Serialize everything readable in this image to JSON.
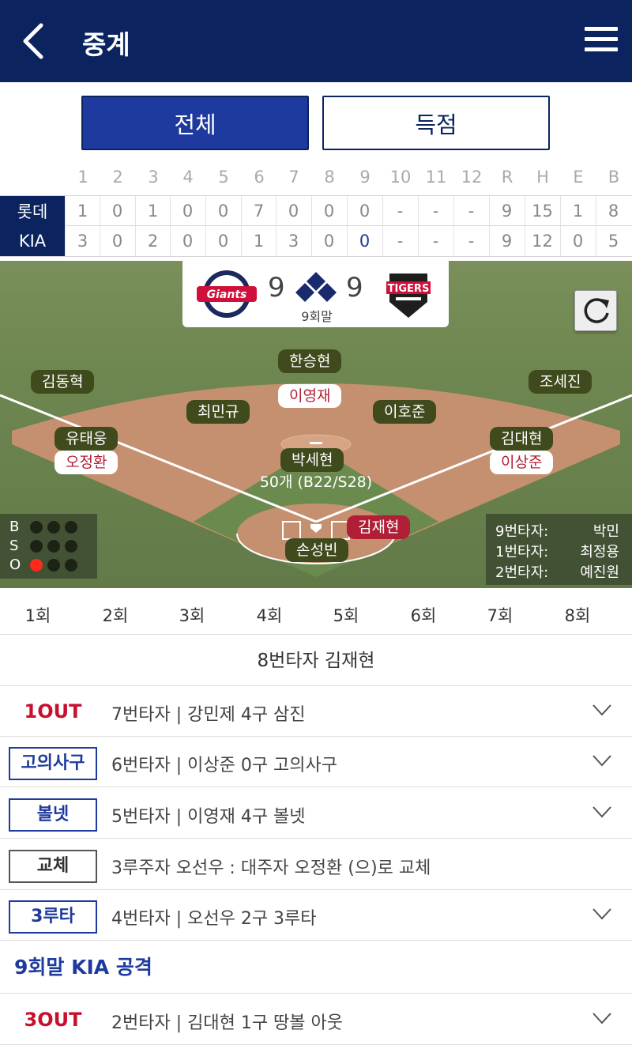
{
  "header": {
    "title": "중계"
  },
  "toggle": {
    "all": "전체",
    "scoring": "득점"
  },
  "scoreboard": {
    "columns": [
      "1",
      "2",
      "3",
      "4",
      "5",
      "6",
      "7",
      "8",
      "9",
      "10",
      "11",
      "12",
      "R",
      "H",
      "E",
      "B"
    ],
    "rows": [
      {
        "team": "롯데",
        "cells": [
          "1",
          "0",
          "1",
          "0",
          "0",
          "7",
          "0",
          "0",
          "0",
          "-",
          "-",
          "-",
          "9",
          "15",
          "1",
          "8"
        ]
      },
      {
        "team": "KIA",
        "cells": [
          "3",
          "0",
          "2",
          "0",
          "0",
          "1",
          "3",
          "0",
          "0",
          "-",
          "-",
          "-",
          "9",
          "12",
          "0",
          "5"
        ]
      }
    ]
  },
  "game": {
    "away_score": "9",
    "home_score": "9",
    "inning": "9회말"
  },
  "field": {
    "fielders": {
      "cf": "한승현",
      "lf": "김동혁",
      "rf": "조세진",
      "ss": "최민규",
      "second": "이호준",
      "third": "유태웅",
      "first": "김대현",
      "pitcher": "박세현",
      "catcher": "손성빈"
    },
    "runners": {
      "second": "이영재",
      "third": "오정환",
      "first": "이상준"
    },
    "batter": "김재현",
    "pitch_count": "50개 (B22/S28)",
    "count": {
      "b_label": "B",
      "s_label": "S",
      "o_label": "O",
      "balls": 0,
      "strikes": 0,
      "outs": 1
    },
    "next_batters": [
      {
        "label": "9번타자:",
        "name": "박민"
      },
      {
        "label": "1번타자:",
        "name": "최정용"
      },
      {
        "label": "2번타자:",
        "name": "예진원"
      }
    ]
  },
  "innings_tabs": [
    "1회",
    "2회",
    "3회",
    "4회",
    "5회",
    "6회",
    "7회",
    "8회"
  ],
  "current_batter_title": "8번타자 김재현",
  "events": [
    {
      "tag": "1OUT",
      "text": "7번타자 | 강민제 4구 삼진"
    },
    {
      "tag": "고의사구",
      "text": "6번타자 | 이상준 0구 고의사구"
    },
    {
      "tag": "볼넷",
      "text": "5번타자 | 이영재 4구 볼넷"
    },
    {
      "tag": "교체",
      "text": "3루주자 오선우 : 대주자 오정환 (으)로 교체"
    },
    {
      "tag": "3루타",
      "text": "4번타자 | 오선우 2구 3루타"
    }
  ],
  "section": {
    "title": "9회말 KIA 공격"
  },
  "events2": [
    {
      "tag": "3OUT",
      "text": "2번타자 | 김대현 1구 땅볼 아웃"
    }
  ],
  "colors": {
    "navy": "#0b2460",
    "blue": "#1e3a9e",
    "red": "#c8102e"
  }
}
